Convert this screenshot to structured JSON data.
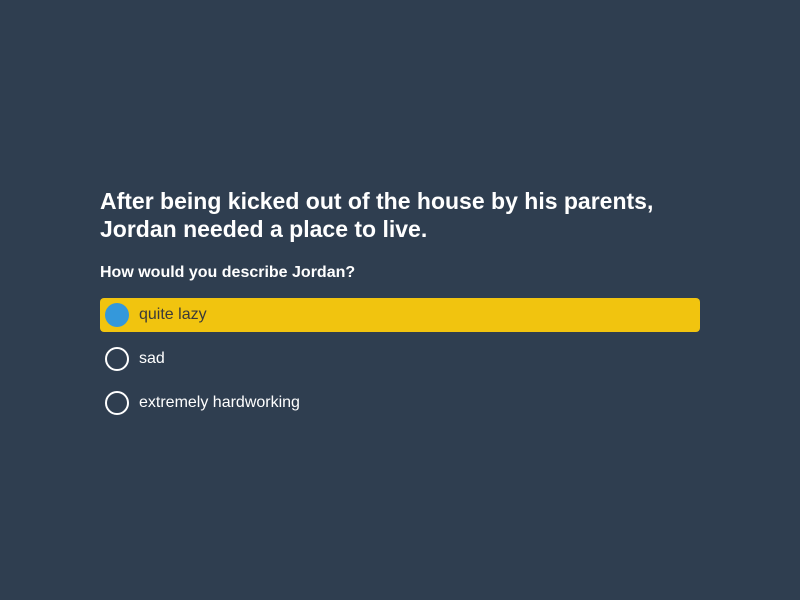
{
  "quiz": {
    "prompt": "After being kicked out of the house by his parents, Jordan needed a place to live.",
    "question": "How would you describe Jordan?",
    "options": [
      {
        "label": "quite lazy",
        "selected": true
      },
      {
        "label": "sad",
        "selected": false
      },
      {
        "label": "extremely hardworking",
        "selected": false
      }
    ]
  },
  "colors": {
    "background": "#2f3e50",
    "selected_highlight": "#f1c40f",
    "radio_checked": "#3498db",
    "text": "#ffffff"
  }
}
